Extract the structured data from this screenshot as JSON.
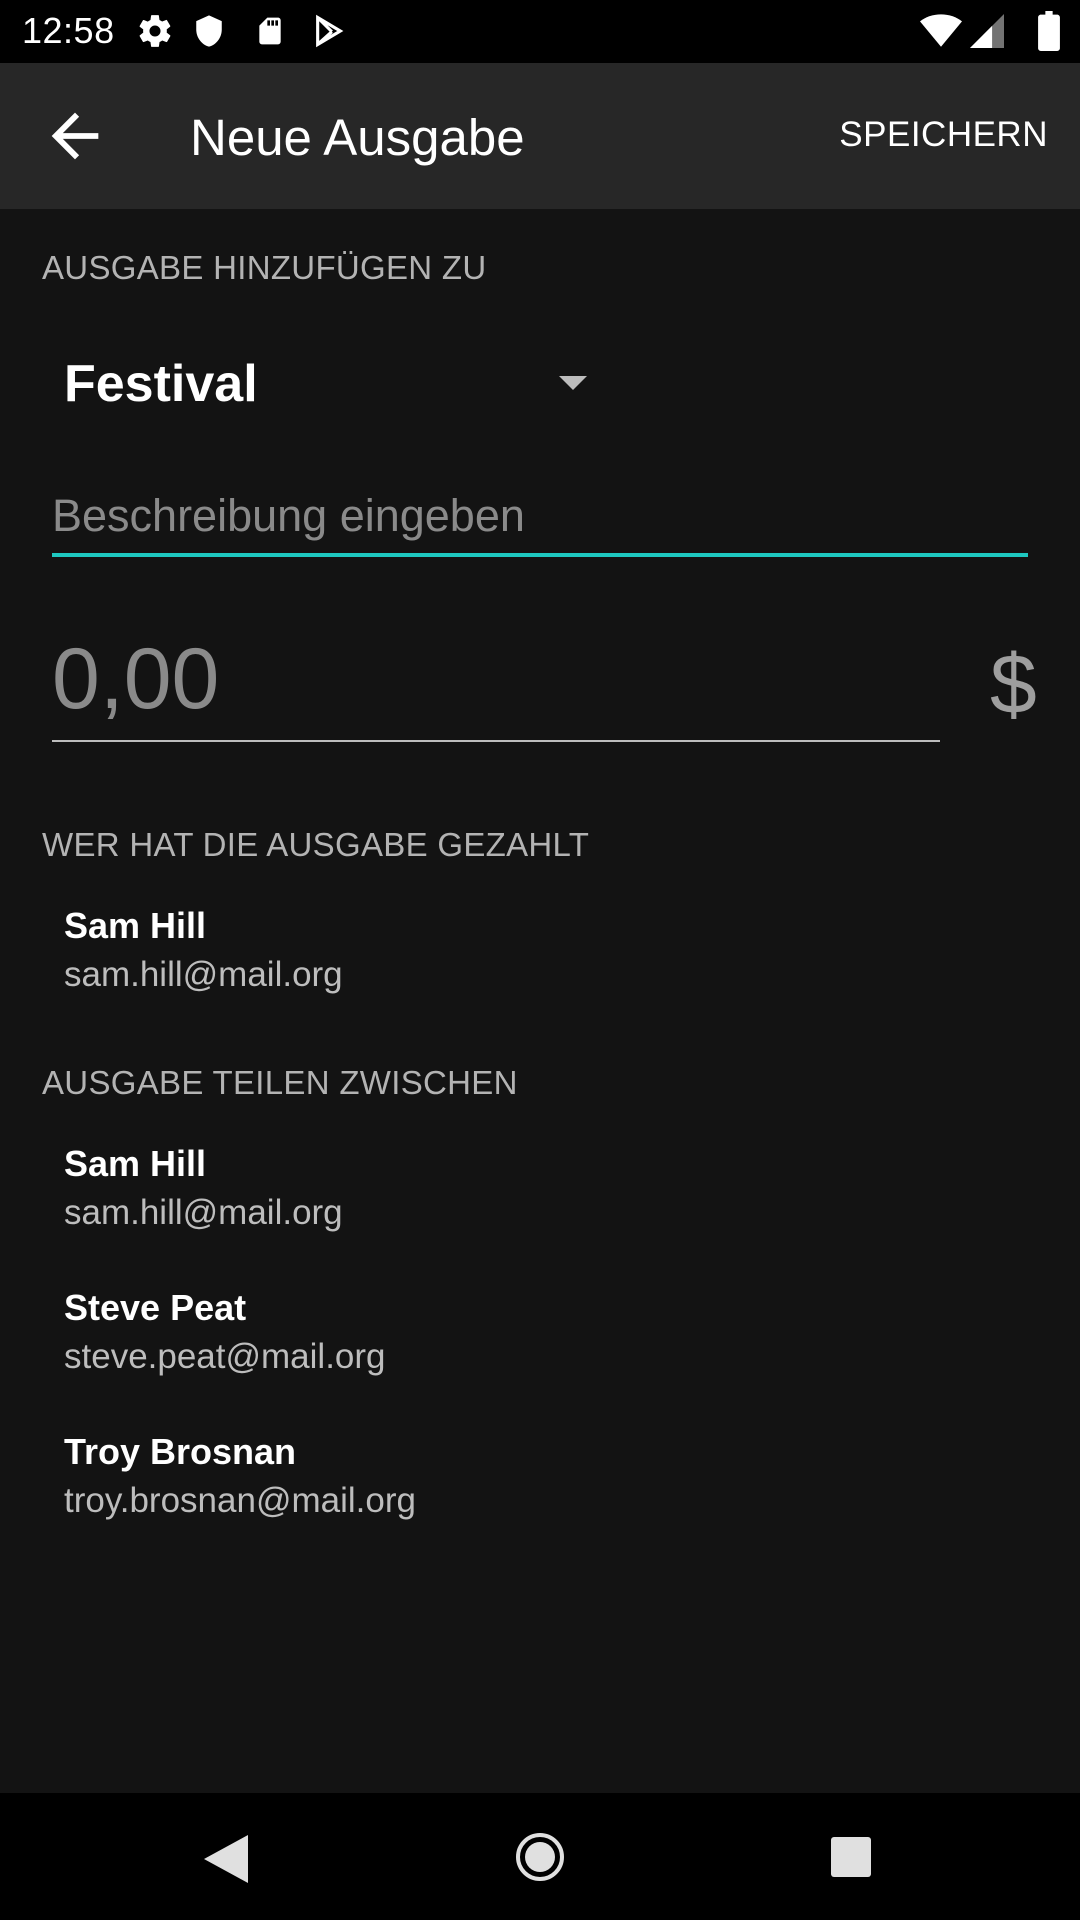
{
  "status_bar": {
    "time": "12:58",
    "left_icons": [
      "gear-icon",
      "shield-icon",
      "sd-card-icon",
      "play-store-icon"
    ],
    "right_icons": [
      "wifi-icon",
      "cell-signal-icon",
      "battery-icon"
    ]
  },
  "app_bar": {
    "title": "Neue Ausgabe",
    "save_label": "SPEICHERN",
    "back_icon": "arrow-left-icon"
  },
  "form": {
    "add_to_label": "AUSGABE HINZUFÜGEN ZU",
    "group_selected": "Festival",
    "description_placeholder": "Beschreibung eingeben",
    "amount_placeholder": "0,00",
    "currency": "$",
    "accent_color": "#1ec8c0"
  },
  "paid_by": {
    "label": "WER HAT DIE AUSGABE GEZAHLT",
    "people": [
      {
        "name": "Sam Hill",
        "email": "sam.hill@mail.org"
      }
    ]
  },
  "split_between": {
    "label": "AUSGABE TEILEN ZWISCHEN",
    "people": [
      {
        "name": "Sam Hill",
        "email": "sam.hill@mail.org"
      },
      {
        "name": "Steve Peat",
        "email": "steve.peat@mail.org"
      },
      {
        "name": "Troy Brosnan",
        "email": "troy.brosnan@mail.org"
      }
    ]
  },
  "nav_bar": {
    "icons": [
      "nav-back-icon",
      "nav-home-icon",
      "nav-recents-icon"
    ]
  }
}
